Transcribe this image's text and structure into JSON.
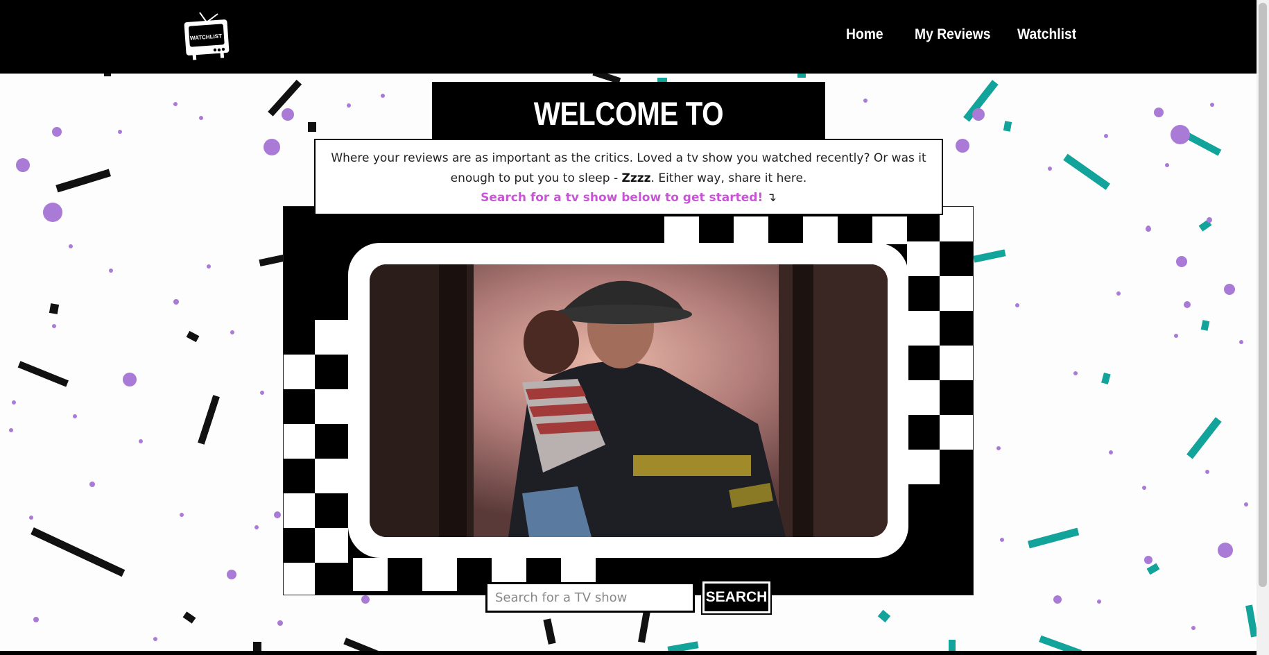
{
  "header": {
    "logo_text": "WATCHLIST",
    "nav": [
      {
        "label": "Home"
      },
      {
        "label": "My Reviews"
      },
      {
        "label": "Watchlist"
      }
    ]
  },
  "hero": {
    "title": "WELCOME TO WATCHLIST",
    "intro_part1": "Where your reviews are as important as the critics. Loved a tv show you watched recently? Or was it enough to put you to sleep - ",
    "intro_emphasis": "Zzzz",
    "intro_part2": ". Either way, share it here.",
    "cta": "Search for a tv show below to get started!",
    "cta_arrow": "↴"
  },
  "search": {
    "placeholder": "Search for a TV show",
    "value": "",
    "button_label": "SEARCH"
  },
  "colors": {
    "purple": "#a97ad6",
    "teal": "#12a39a",
    "cta": "#c855d6",
    "black": "#000000"
  },
  "media": {
    "image": "firefighter-carrying-child"
  }
}
